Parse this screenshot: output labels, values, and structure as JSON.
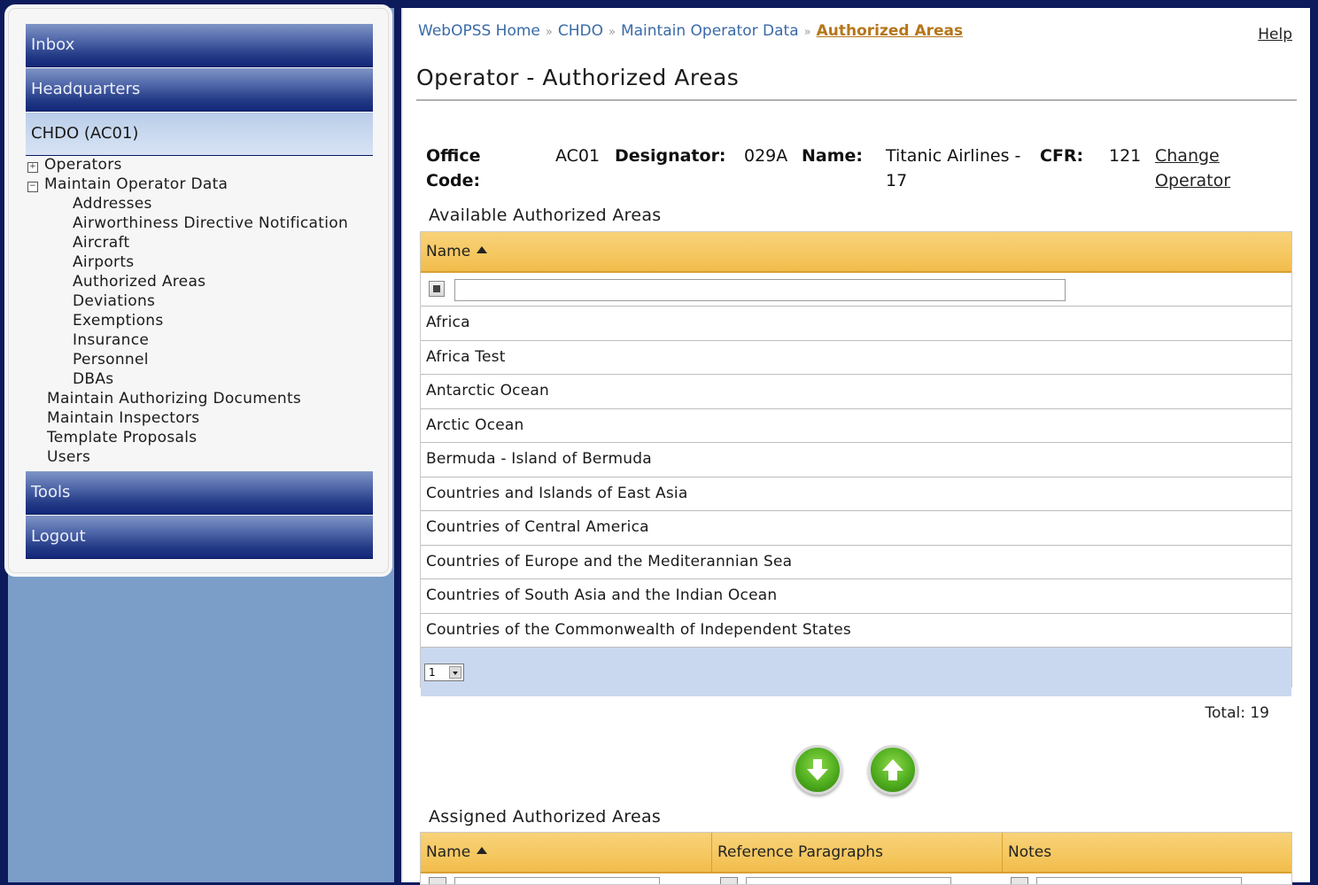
{
  "sidebar": {
    "inbox": "Inbox",
    "headquarters": "Headquarters",
    "office": "CHDO (AC01)",
    "tree": {
      "operators": "Operators",
      "maintain_operator_data": "Maintain Operator Data",
      "children": [
        "Addresses",
        "Airworthiness Directive Notification",
        "Aircraft",
        "Airports",
        "Authorized Areas",
        "Deviations",
        "Exemptions",
        "Insurance",
        "Personnel",
        "DBAs"
      ],
      "maintain_authorizing_documents": "Maintain Authorizing Documents",
      "maintain_inspectors": "Maintain Inspectors",
      "template_proposals": "Template Proposals",
      "users": "Users"
    },
    "tools": "Tools",
    "logout": "Logout"
  },
  "breadcrumb": {
    "items": [
      "WebOPSS Home",
      "CHDO",
      "Maintain Operator Data"
    ],
    "separator": "»",
    "current": "Authorized Areas"
  },
  "help": "Help",
  "page_title": "Operator - Authorized Areas",
  "operator": {
    "office_label_1": "Office",
    "office_label_2": "Code:",
    "office_value": "AC01",
    "designator_label": "Designator:",
    "designator_value": "029A",
    "name_label": "Name:",
    "name_value_1": "Titanic Airlines -",
    "name_value_2": "17",
    "cfr_label": "CFR:",
    "cfr_value": "121",
    "change_1": "Change",
    "change_2": "Operator"
  },
  "available": {
    "title": "Available Authorized Areas",
    "column": "Name",
    "filter_value": "",
    "rows": [
      "Africa",
      "Africa Test",
      "Antarctic Ocean",
      "Arctic Ocean",
      "Bermuda - Island of Bermuda",
      "Countries and Islands of East Asia",
      "Countries of Central America",
      "Countries of Europe and the Mediterannian Sea",
      "Countries of South Asia and the Indian Ocean",
      "Countries of the Commonwealth of Independent States"
    ],
    "page": "1",
    "total": "Total: 19"
  },
  "assigned": {
    "title": "Assigned Authorized Areas",
    "columns": [
      "Name",
      "Reference Paragraphs",
      "Notes"
    ]
  },
  "icons": {
    "move_down": "arrow-down-icon",
    "move_up": "arrow-up-icon"
  },
  "colors": {
    "nav_dark": "#13277a",
    "nav_active": "#c9d9ef",
    "grid_header": "#f5c75f",
    "pager_bg": "#c9d8ee",
    "link": "#3a6aa8",
    "current_crumb": "#b5761a",
    "button_green": "#4fae1e"
  }
}
